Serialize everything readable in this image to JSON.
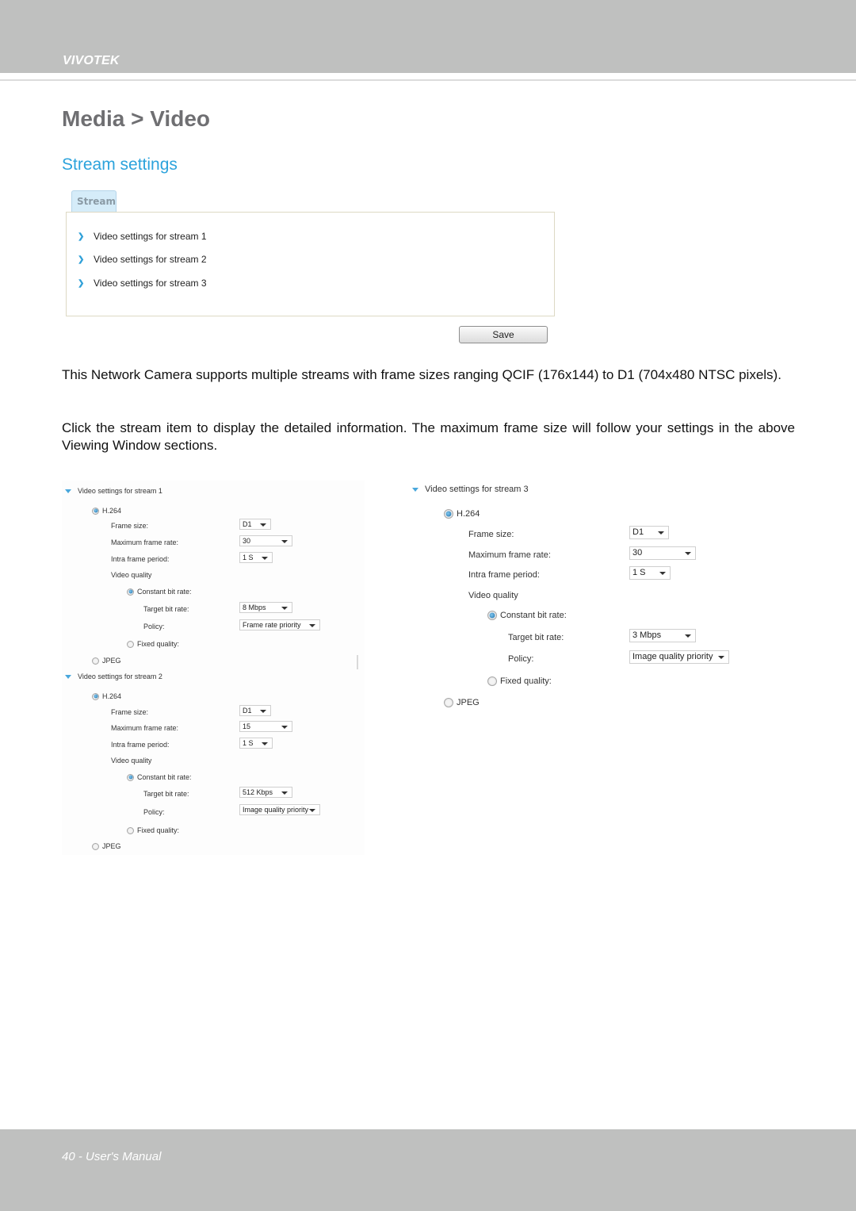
{
  "header": {
    "brand": "VIVOTEK"
  },
  "page_title": "Media > Video",
  "section_title": "Stream settings",
  "stream_panel": {
    "tab_label": "Stream",
    "links": [
      "Video settings for stream 1",
      "Video settings for stream 2",
      "Video settings for stream 3"
    ],
    "save_label": "Save"
  },
  "paragraphs": [
    "This Network Camera supports multiple streams with frame sizes ranging QCIF (176x144) to D1 (704x480 NTSC pixels).",
    "Click the stream item to display the detailed information. The maximum frame size will follow your settings in the above Viewing Window sections."
  ],
  "labels": {
    "h264": "H.264",
    "frame_size": "Frame size:",
    "max_frame_rate": "Maximum frame rate:",
    "intra_frame_period": "Intra frame period:",
    "video_quality": "Video quality",
    "constant_bit_rate": "Constant bit rate:",
    "target_bit_rate": "Target bit rate:",
    "policy": "Policy:",
    "fixed_quality": "Fixed quality:",
    "jpeg": "JPEG"
  },
  "streams": [
    {
      "title": "Video settings for stream 1",
      "codec": "H.264",
      "frame_size": "D1",
      "max_frame_rate": "30",
      "intra_frame_period": "1 S",
      "quality_mode": "Constant bit rate",
      "target_bit_rate": "8 Mbps",
      "policy": "Frame rate priority"
    },
    {
      "title": "Video settings for stream 2",
      "codec": "H.264",
      "frame_size": "D1",
      "max_frame_rate": "15",
      "intra_frame_period": "1 S",
      "quality_mode": "Constant bit rate",
      "target_bit_rate": "512 Kbps",
      "policy": "Image quality priority"
    },
    {
      "title": "Video settings for stream 3",
      "codec": "H.264",
      "frame_size": "D1",
      "max_frame_rate": "30",
      "intra_frame_period": "1 S",
      "quality_mode": "Constant bit rate",
      "target_bit_rate": "3 Mbps",
      "policy": "Image quality priority"
    }
  ],
  "footer": {
    "text": "40 - User's Manual"
  }
}
